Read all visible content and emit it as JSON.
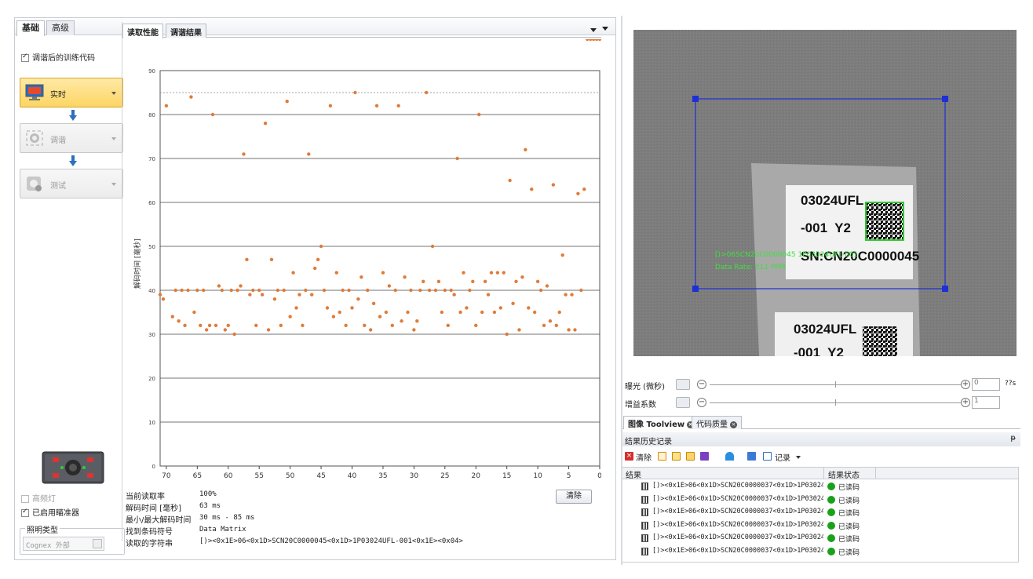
{
  "top_tabs": [
    "基础",
    "高级"
  ],
  "left": {
    "train_checkbox": "调谐后的训练代码",
    "workflow": [
      {
        "label": "实时",
        "icon": "monitor-icon",
        "state": "active"
      },
      {
        "label": "调谐",
        "icon": "tune-icon",
        "state": "disabled"
      },
      {
        "label": "测试",
        "icon": "test-icon",
        "state": "disabled"
      }
    ],
    "high_freq_light": "高频灯",
    "aimer_enabled": "已启用瞄准器",
    "lighting_group": "照明类型",
    "lighting_value": "Cognex 外部"
  },
  "subtabs": [
    "读取性能",
    "调谐结果"
  ],
  "chart_data": {
    "type": "scatter",
    "ylabel": "解码时间 [毫秒]",
    "ylim": [
      0,
      90
    ],
    "yticks": [
      0,
      10,
      20,
      30,
      40,
      50,
      60,
      70,
      80,
      90
    ],
    "xticks": [
      70,
      65,
      60,
      55,
      50,
      45,
      40,
      35,
      30,
      25,
      20,
      15,
      10,
      5,
      0
    ],
    "xlim": [
      71,
      0
    ],
    "reference_line": 85,
    "color": "#e07b39",
    "x": [
      71,
      70.5,
      70,
      69,
      68.5,
      68,
      67.5,
      67,
      66.5,
      66,
      65.5,
      65,
      64.5,
      64,
      63.5,
      63,
      62.5,
      62,
      61.5,
      61,
      60.5,
      60,
      59.5,
      59,
      58.5,
      58,
      57.5,
      57,
      56.5,
      56,
      55.5,
      55,
      54.5,
      54,
      53.5,
      53,
      52.5,
      52,
      51.5,
      51,
      50.5,
      50,
      49.5,
      49,
      48.5,
      48,
      47.5,
      47,
      46.5,
      46,
      45.5,
      45,
      44.5,
      44,
      43.5,
      43,
      42.5,
      42,
      41.5,
      41,
      40.5,
      40,
      39.5,
      39,
      38.5,
      38,
      37.5,
      37,
      36.5,
      36,
      35.5,
      35,
      34.5,
      34,
      33.5,
      33,
      32.5,
      32,
      31.5,
      31,
      30.5,
      30,
      29.5,
      29,
      28.5,
      28,
      27.5,
      27,
      26.5,
      26,
      25.5,
      25,
      24.5,
      24,
      23.5,
      23,
      22.5,
      22,
      21.5,
      21,
      20.5,
      20,
      19.5,
      19,
      18.5,
      18,
      17.5,
      17,
      16.5,
      16,
      15.5,
      15,
      14.5,
      14,
      13.5,
      13,
      12.5,
      12,
      11.5,
      11,
      10.5,
      10,
      9.5,
      9,
      8.5,
      8,
      7.5,
      7,
      6.5,
      6,
      5.5,
      5,
      4.5,
      4,
      3.5,
      3,
      2.5,
      2,
      1.5,
      1,
      0.5,
      0
    ],
    "y": [
      39,
      38,
      82,
      34,
      40,
      33,
      40,
      32,
      40,
      84,
      35,
      40,
      32,
      40,
      31,
      32,
      80,
      32,
      41,
      40,
      31,
      32,
      40,
      30,
      40,
      41,
      71,
      47,
      39,
      40,
      32,
      40,
      39,
      78,
      31,
      47,
      38,
      40,
      32,
      40,
      83,
      34,
      44,
      36,
      39,
      32,
      40,
      71,
      39,
      45,
      47,
      50,
      40,
      36,
      82,
      34,
      44,
      35,
      40,
      32,
      40,
      36,
      85,
      38,
      43,
      32,
      40,
      31,
      37,
      82,
      34,
      44,
      35,
      41,
      32,
      40,
      82,
      33,
      43,
      35,
      40,
      31,
      33,
      40,
      42,
      85,
      40,
      50,
      40,
      42,
      35,
      40,
      32,
      40,
      39,
      70,
      35,
      44,
      36,
      40,
      42,
      32,
      80,
      35,
      42,
      39,
      44,
      35,
      44,
      36,
      44,
      30,
      65,
      37,
      42,
      31,
      43,
      72,
      36,
      63,
      35,
      42,
      40,
      32,
      41,
      33,
      64,
      32,
      35,
      48,
      39,
      31,
      39,
      31,
      62,
      40,
      63
    ]
  },
  "stats": [
    {
      "label": "当前读取率",
      "value": "100%"
    },
    {
      "label": "解码时间 [毫秒]",
      "value": "63 ms"
    },
    {
      "label": "最小/最大解码时间",
      "value": "30 ms - 85 ms"
    },
    {
      "label": "找到条码符号",
      "value": "Data Matrix"
    },
    {
      "label": "读取的字符串",
      "value": "[)><0x1E>06<0x1D>SCN20C0000045<0x1D>1P03024UFL-001<0x1E><0x04>"
    }
  ],
  "clear_button": "清除",
  "image": {
    "label1_line1": "03024UFL",
    "label1_line2": "-001  Y2",
    "label1_line3": "SN:CN20C0000045",
    "label2_line1": "03024UFL",
    "label2_line2": "-001  Y2",
    "overlay_line1": "[)>06SCN20C0000045 1P03024UFL-001",
    "overlay_line2": "Data Rate: 511 PPM"
  },
  "sliders": [
    {
      "label": "曝光 (微秒)",
      "value": "0",
      "unit": "??s"
    },
    {
      "label": "增益系数",
      "value": "1",
      "unit": ""
    }
  ],
  "bottom_tabs": [
    "图像 Toolview",
    "代码质量"
  ],
  "history_title": "结果历史记录",
  "history_pin": "ᵽ",
  "toolbar": {
    "clear": "清除",
    "record": "记录"
  },
  "results": {
    "columns": [
      "结果",
      "结果状态"
    ],
    "rows": [
      {
        "text": "[)><0x1E>06<0x1D>SCN20C0000037<0x1D>1P03024···",
        "status": "已读码"
      },
      {
        "text": "[)><0x1E>06<0x1D>SCN20C0000037<0x1D>1P03024···",
        "status": "已读码"
      },
      {
        "text": "[)><0x1E>06<0x1D>SCN20C0000037<0x1D>1P03024···",
        "status": "已读码"
      },
      {
        "text": "[)><0x1E>06<0x1D>SCN20C0000037<0x1D>1P03024···",
        "status": "已读码"
      },
      {
        "text": "[)><0x1E>06<0x1D>SCN20C0000037<0x1D>1P03024···",
        "status": "已读码"
      },
      {
        "text": "[)><0x1E>06<0x1D>SCN20C0000037<0x1D>1P03024···",
        "status": "已读码"
      }
    ]
  }
}
